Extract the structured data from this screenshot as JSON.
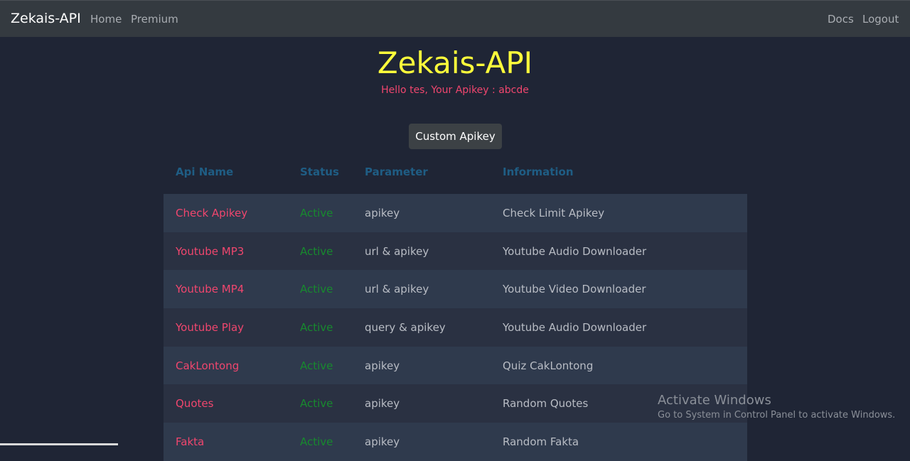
{
  "nav": {
    "brand": "Zekais-API",
    "left_links": [
      "Home",
      "Premium"
    ],
    "right_links": [
      "Docs",
      "Logout"
    ]
  },
  "hero": {
    "title": "Zekais-API",
    "greeting": "Hello tes, Your Apikey : abcde",
    "custom_button": "Custom Apikey"
  },
  "table": {
    "headers": [
      "Api Name",
      "Status",
      "Parameter",
      "Information"
    ],
    "rows": [
      {
        "name": "Check Apikey",
        "status": "Active",
        "param": "apikey",
        "info": "Check Limit Apikey"
      },
      {
        "name": "Youtube MP3",
        "status": "Active",
        "param": "url & apikey",
        "info": "Youtube Audio Downloader"
      },
      {
        "name": "Youtube MP4",
        "status": "Active",
        "param": "url & apikey",
        "info": "Youtube Video Downloader"
      },
      {
        "name": "Youtube Play",
        "status": "Active",
        "param": "query & apikey",
        "info": "Youtube Audio Downloader"
      },
      {
        "name": "CakLontong",
        "status": "Active",
        "param": "apikey",
        "info": "Quiz CakLontong"
      },
      {
        "name": "Quotes",
        "status": "Active",
        "param": "apikey",
        "info": "Random Quotes"
      },
      {
        "name": "Fakta",
        "status": "Active",
        "param": "apikey",
        "info": "Random Fakta"
      }
    ]
  },
  "watermark": {
    "title": "Activate Windows",
    "subtitle": "Go to System in Control Panel to activate Windows."
  },
  "colors": {
    "navbar": "#343a40",
    "background": "#1f2535",
    "title": "#ffff3b",
    "accent_pink": "#f0466e",
    "status_green": "#178a2e",
    "header_blue": "#1f5d84"
  }
}
